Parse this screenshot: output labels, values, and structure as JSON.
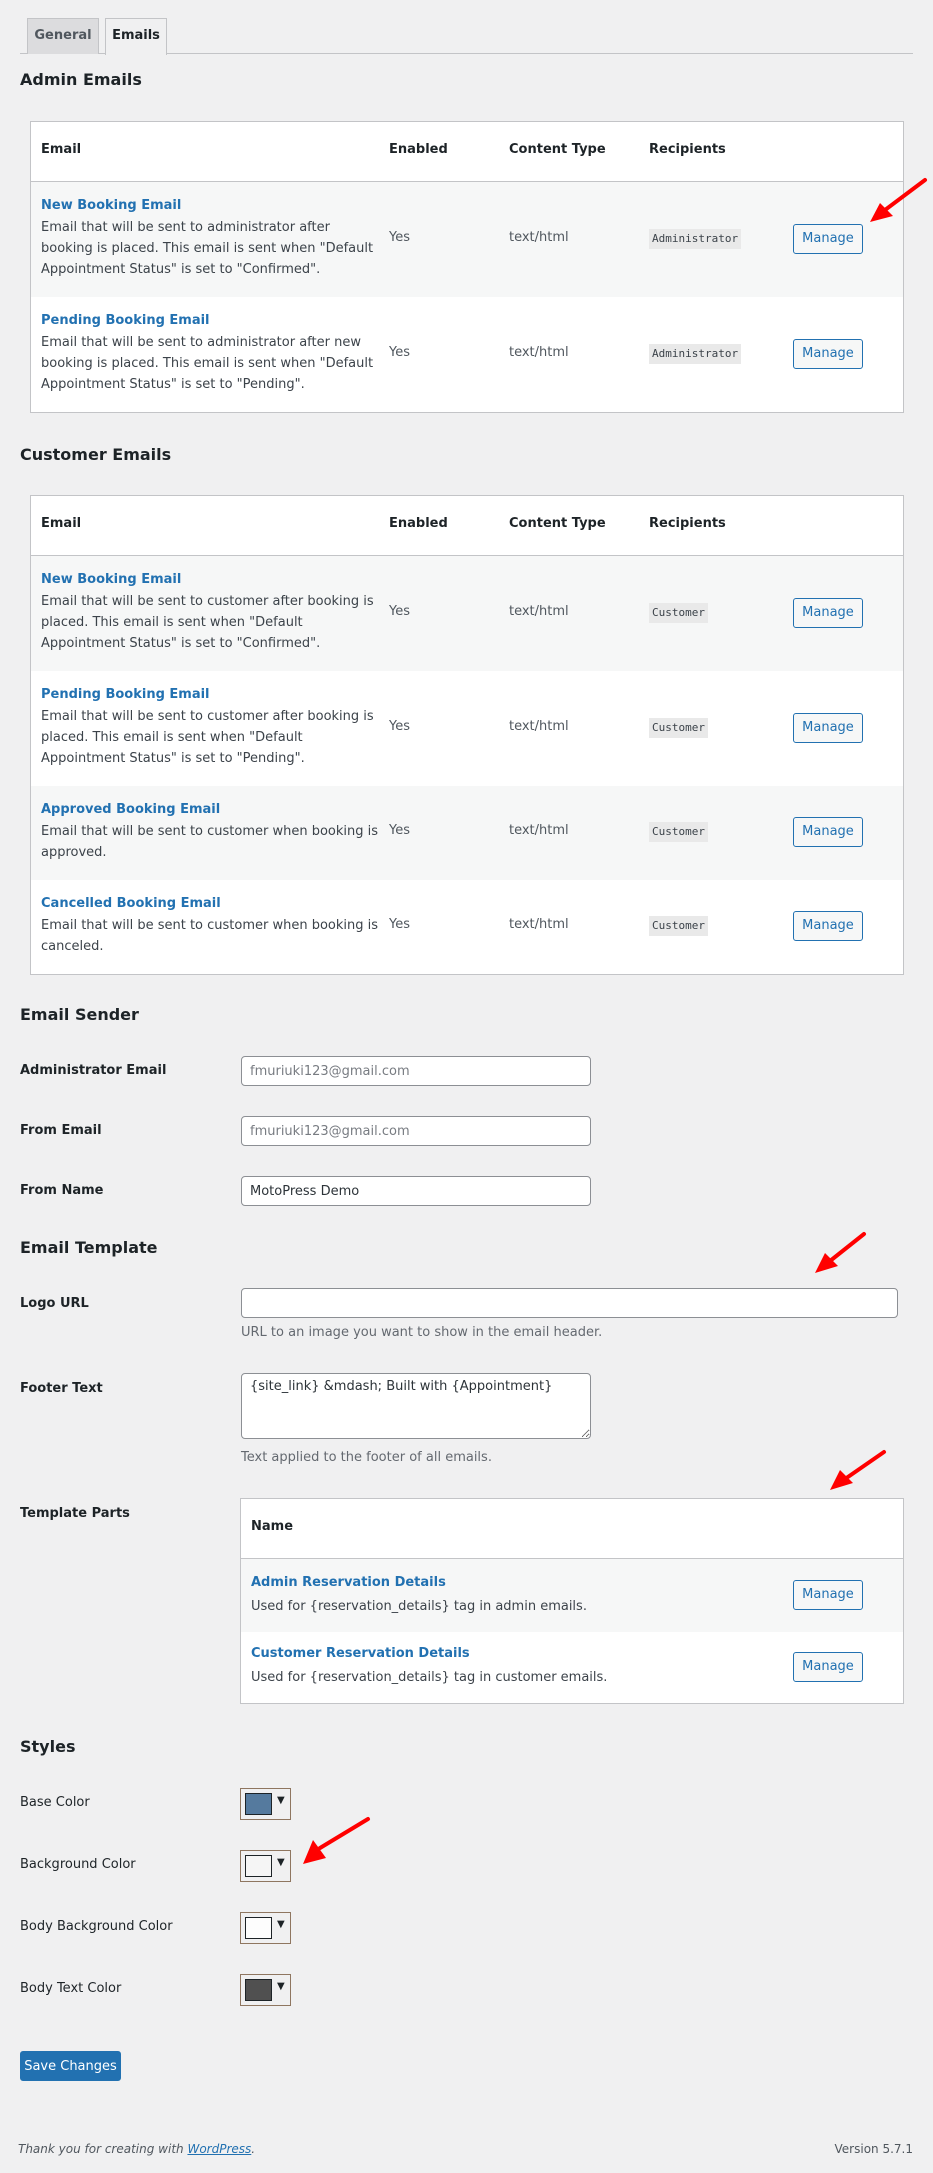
{
  "tabs": [
    {
      "label": "General",
      "active": false
    },
    {
      "label": "Emails",
      "active": true
    }
  ],
  "admin_emails": {
    "heading": "Admin Emails",
    "columns": [
      "Email",
      "Enabled",
      "Content Type",
      "Recipients"
    ],
    "rows": [
      {
        "title": "New Booking Email",
        "description": "Email that will be sent to administrator after booking is placed. This email is sent when \"Default Appointment Status\" is set to \"Confirmed\".",
        "enabled": "Yes",
        "content_type": "text/html",
        "recipients": "Administrator",
        "action": "Manage"
      },
      {
        "title": "Pending Booking Email",
        "description": "Email that will be sent to administrator after new booking is placed. This email is sent when \"Default Appointment Status\" is set to \"Pending\".",
        "enabled": "Yes",
        "content_type": "text/html",
        "recipients": "Administrator",
        "action": "Manage"
      }
    ]
  },
  "customer_emails": {
    "heading": "Customer Emails",
    "columns": [
      "Email",
      "Enabled",
      "Content Type",
      "Recipients"
    ],
    "rows": [
      {
        "title": "New Booking Email",
        "description": "Email that will be sent to customer after booking is placed. This email is sent when \"Default Appointment Status\" is set to \"Confirmed\".",
        "enabled": "Yes",
        "content_type": "text/html",
        "recipients": "Customer",
        "action": "Manage"
      },
      {
        "title": "Pending Booking Email",
        "description": "Email that will be sent to customer after booking is placed. This email is sent when \"Default Appointment Status\" is set to \"Pending\".",
        "enabled": "Yes",
        "content_type": "text/html",
        "recipients": "Customer",
        "action": "Manage"
      },
      {
        "title": "Approved Booking Email",
        "description": "Email that will be sent to customer when booking is approved.",
        "enabled": "Yes",
        "content_type": "text/html",
        "recipients": "Customer",
        "action": "Manage"
      },
      {
        "title": "Cancelled Booking Email",
        "description": "Email that will be sent to customer when booking is canceled.",
        "enabled": "Yes",
        "content_type": "text/html",
        "recipients": "Customer",
        "action": "Manage"
      }
    ]
  },
  "email_sender": {
    "heading": "Email Sender",
    "admin_email": {
      "label": "Administrator Email",
      "value": "",
      "placeholder": "fmuriuki123@gmail.com"
    },
    "from_email": {
      "label": "From Email",
      "value": "",
      "placeholder": "fmuriuki123@gmail.com"
    },
    "from_name": {
      "label": "From Name",
      "value": "MotoPress Demo",
      "placeholder": ""
    }
  },
  "email_template": {
    "heading": "Email Template",
    "logo_url": {
      "label": "Logo URL",
      "value": "",
      "description": "URL to an image you want to show in the email header."
    },
    "footer_text": {
      "label": "Footer Text",
      "value": "{site_link} &mdash; Built with {Appointment}",
      "description": "Text applied to the footer of all emails."
    },
    "template_parts": {
      "label": "Template Parts",
      "column": "Name",
      "rows": [
        {
          "title": "Admin Reservation Details",
          "description": "Used for {reservation_details} tag in admin emails.",
          "action": "Manage"
        },
        {
          "title": "Customer Reservation Details",
          "description": "Used for {reservation_details} tag in customer emails.",
          "action": "Manage"
        }
      ]
    }
  },
  "styles": {
    "heading": "Styles",
    "items": [
      {
        "label": "Base Color",
        "color": "#557a9e"
      },
      {
        "label": "Background Color",
        "color": "#f5f5f5"
      },
      {
        "label": "Body Background Color",
        "color": "#fdfdfd"
      },
      {
        "label": "Body Text Color",
        "color": "#505050"
      }
    ]
  },
  "save_label": "Save Changes",
  "footer": {
    "thanks_prefix": "Thank you for creating with ",
    "thanks_link": "WordPress",
    "thanks_suffix": ".",
    "version": "Version 5.7.1"
  },
  "annotation_color": "#ff0000"
}
